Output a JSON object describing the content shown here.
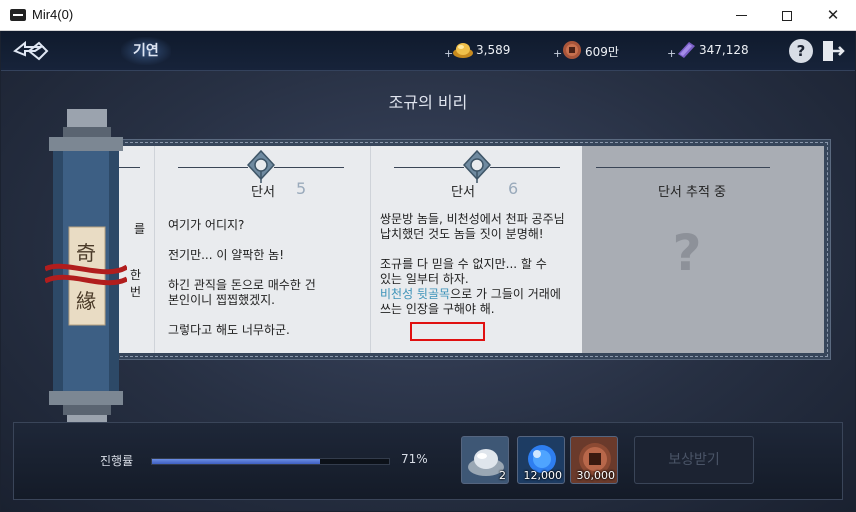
{
  "window": {
    "title": "Mir4(0)"
  },
  "header": {
    "title": "기연",
    "currencies": [
      {
        "name": "gold",
        "value": "3,589",
        "icon": "gold-ingot-icon"
      },
      {
        "name": "copper",
        "value": "609만",
        "icon": "copper-coin-icon"
      },
      {
        "name": "darksteel",
        "value": "347,128",
        "icon": "darksteel-icon"
      }
    ],
    "help_label": "?"
  },
  "panel": {
    "title": "조규의 비리"
  },
  "scroll": {
    "characters": [
      "奇",
      "緣"
    ]
  },
  "cards": {
    "partial": {
      "fragments": [
        "를",
        "한 번"
      ]
    },
    "card5": {
      "heading": "단서",
      "number": "5",
      "lines": [
        "여기가 어디지?",
        "전기만... 이 얄팍한 놈!",
        "하긴 관직을 돈으로 매수한 건",
        "본인이니 찝찝했겠지.",
        "그렇다고 해도 너무하군."
      ]
    },
    "card6": {
      "heading": "단서",
      "number": "6",
      "lines": [
        "쌍문방 놈들, 비천성에서 천파 공주님",
        "납치했던 것도 놈들 짓이 분명해!",
        "조규를 다 믿을 수 없지만... 할 수",
        "있는 일부터 하자."
      ],
      "link": "비천성 뒷골목",
      "after_link": "으로 가 그들이 거래에",
      "last_line": "쓰는 인장을 구해야 해."
    },
    "locked": {
      "heading": "단서 추적 중",
      "mark": "?"
    }
  },
  "progress": {
    "label": "진행률",
    "percent_text": "71%",
    "value": 0.71
  },
  "rewards": [
    {
      "name": "silver-ingot",
      "qty": "2"
    },
    {
      "name": "blue-orb",
      "qty": "12,000"
    },
    {
      "name": "copper-coin",
      "qty": "30,000"
    }
  ],
  "claim_label": "보상받기"
}
